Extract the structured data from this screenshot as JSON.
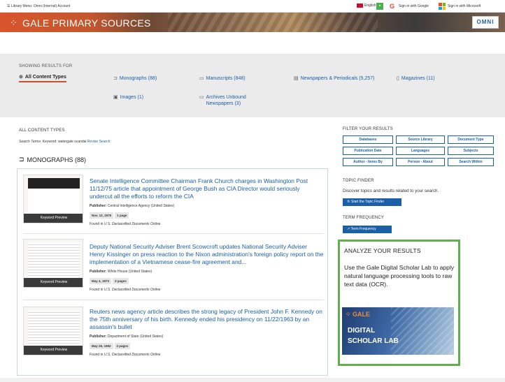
{
  "topbar": {
    "menu": "☰ Library Menu: Omni (Internal) Account",
    "lang": "English",
    "google_signin": "Sign in with Google",
    "ms_signin": "Sign in with Microsoft"
  },
  "banner": {
    "title": "GALE PRIMARY SOURCES",
    "omni": "OMNI"
  },
  "filters": {
    "showing_label": "SHOWING RESULTS FOR",
    "types": [
      {
        "label": "All Content Types",
        "icon": "globe-icon"
      },
      {
        "label": "Monographs (88)",
        "icon": "book-icon"
      },
      {
        "label": "Manuscripts (848)",
        "icon": "manuscript-icon"
      },
      {
        "label": "Newspapers & Periodicals (5,257)",
        "icon": "newspaper-icon"
      },
      {
        "label": "Magazines (11)",
        "icon": "magazine-icon"
      },
      {
        "label": "Images (1)",
        "icon": "image-icon"
      },
      {
        "label": "Archives Unbound Newspapers (3)",
        "icon": "archive-icon"
      }
    ]
  },
  "results": {
    "section_label": "ALL CONTENT TYPES",
    "search_terms_label": "Search Terms:",
    "search_terms_value": "Keyword: watergate scandal",
    "revise": "Revise Search",
    "monographs_header": "MONOGRAPHS (88)",
    "items": [
      {
        "title": "Senate Intelligence Committee Chairman Frank Church charges in Washington Post 11/12/75 article that appointment of George Bush as CIA Director would seriously undercut all the efforts to reform the CIA",
        "publisher_label": "Publisher:",
        "publisher": "Central Intelligence Agency (United States)",
        "date": "Nov. 12, 1975",
        "pages": "1 page",
        "found_prefix": "Found in",
        "found_in": "U.S. Declassified Documents Online",
        "preview": "Keyword Preview"
      },
      {
        "title": "Deputy National Security Adviser Brent Scowcroft updates National Security Adviser Henry Kissinger on press reaction to the Nixon administration's foreign policy report on the implementation of a Vietnamese cease-fire agreement and...",
        "publisher_label": "Publisher:",
        "publisher": "White House (United States)",
        "date": "May 4, 1973",
        "pages": "3 pages",
        "found_prefix": "Found in",
        "found_in": "U.S. Declassified Documents Online",
        "preview": "Keyword Preview"
      },
      {
        "title": "Reuters news agency article describes the strong legacy of President John F. Kennedy on the 75th anniversary of his birth. Kennedy ended his presidency on 11/22/1963 by an assassin's bullet",
        "publisher_label": "Publisher:",
        "publisher": "Department of State (United States)",
        "date": "May 26, 1992",
        "pages": "3 pages",
        "found_prefix": "Found in",
        "found_in": "U.S. Declassified Documents Online",
        "preview": "Keyword Preview"
      }
    ]
  },
  "sidebar": {
    "filter_label": "FILTER YOUR RESULTS",
    "filter_buttons": [
      "Databases",
      "Source Library",
      "Document Type",
      "Publication Date",
      "Languages",
      "Subjects",
      "Author - Items By",
      "Person - About",
      "Search Within"
    ],
    "topic_label": "TOPIC FINDER",
    "topic_desc": "Discover topics and results related to your search.",
    "topic_btn": "Start the Topic Finder",
    "term_label": "TERM FREQUENCY",
    "term_btn": "Term Frequency",
    "analyze_title": "ANALYZE YOUR RESULTS",
    "analyze_text": "Use the Gale Digital Scholar Lab to apply natural language processing tools to raw text data (OCR).",
    "dsl_brand": "GALE",
    "dsl_line1": "DIGITAL",
    "dsl_line2": "SCHOLAR LAB"
  }
}
